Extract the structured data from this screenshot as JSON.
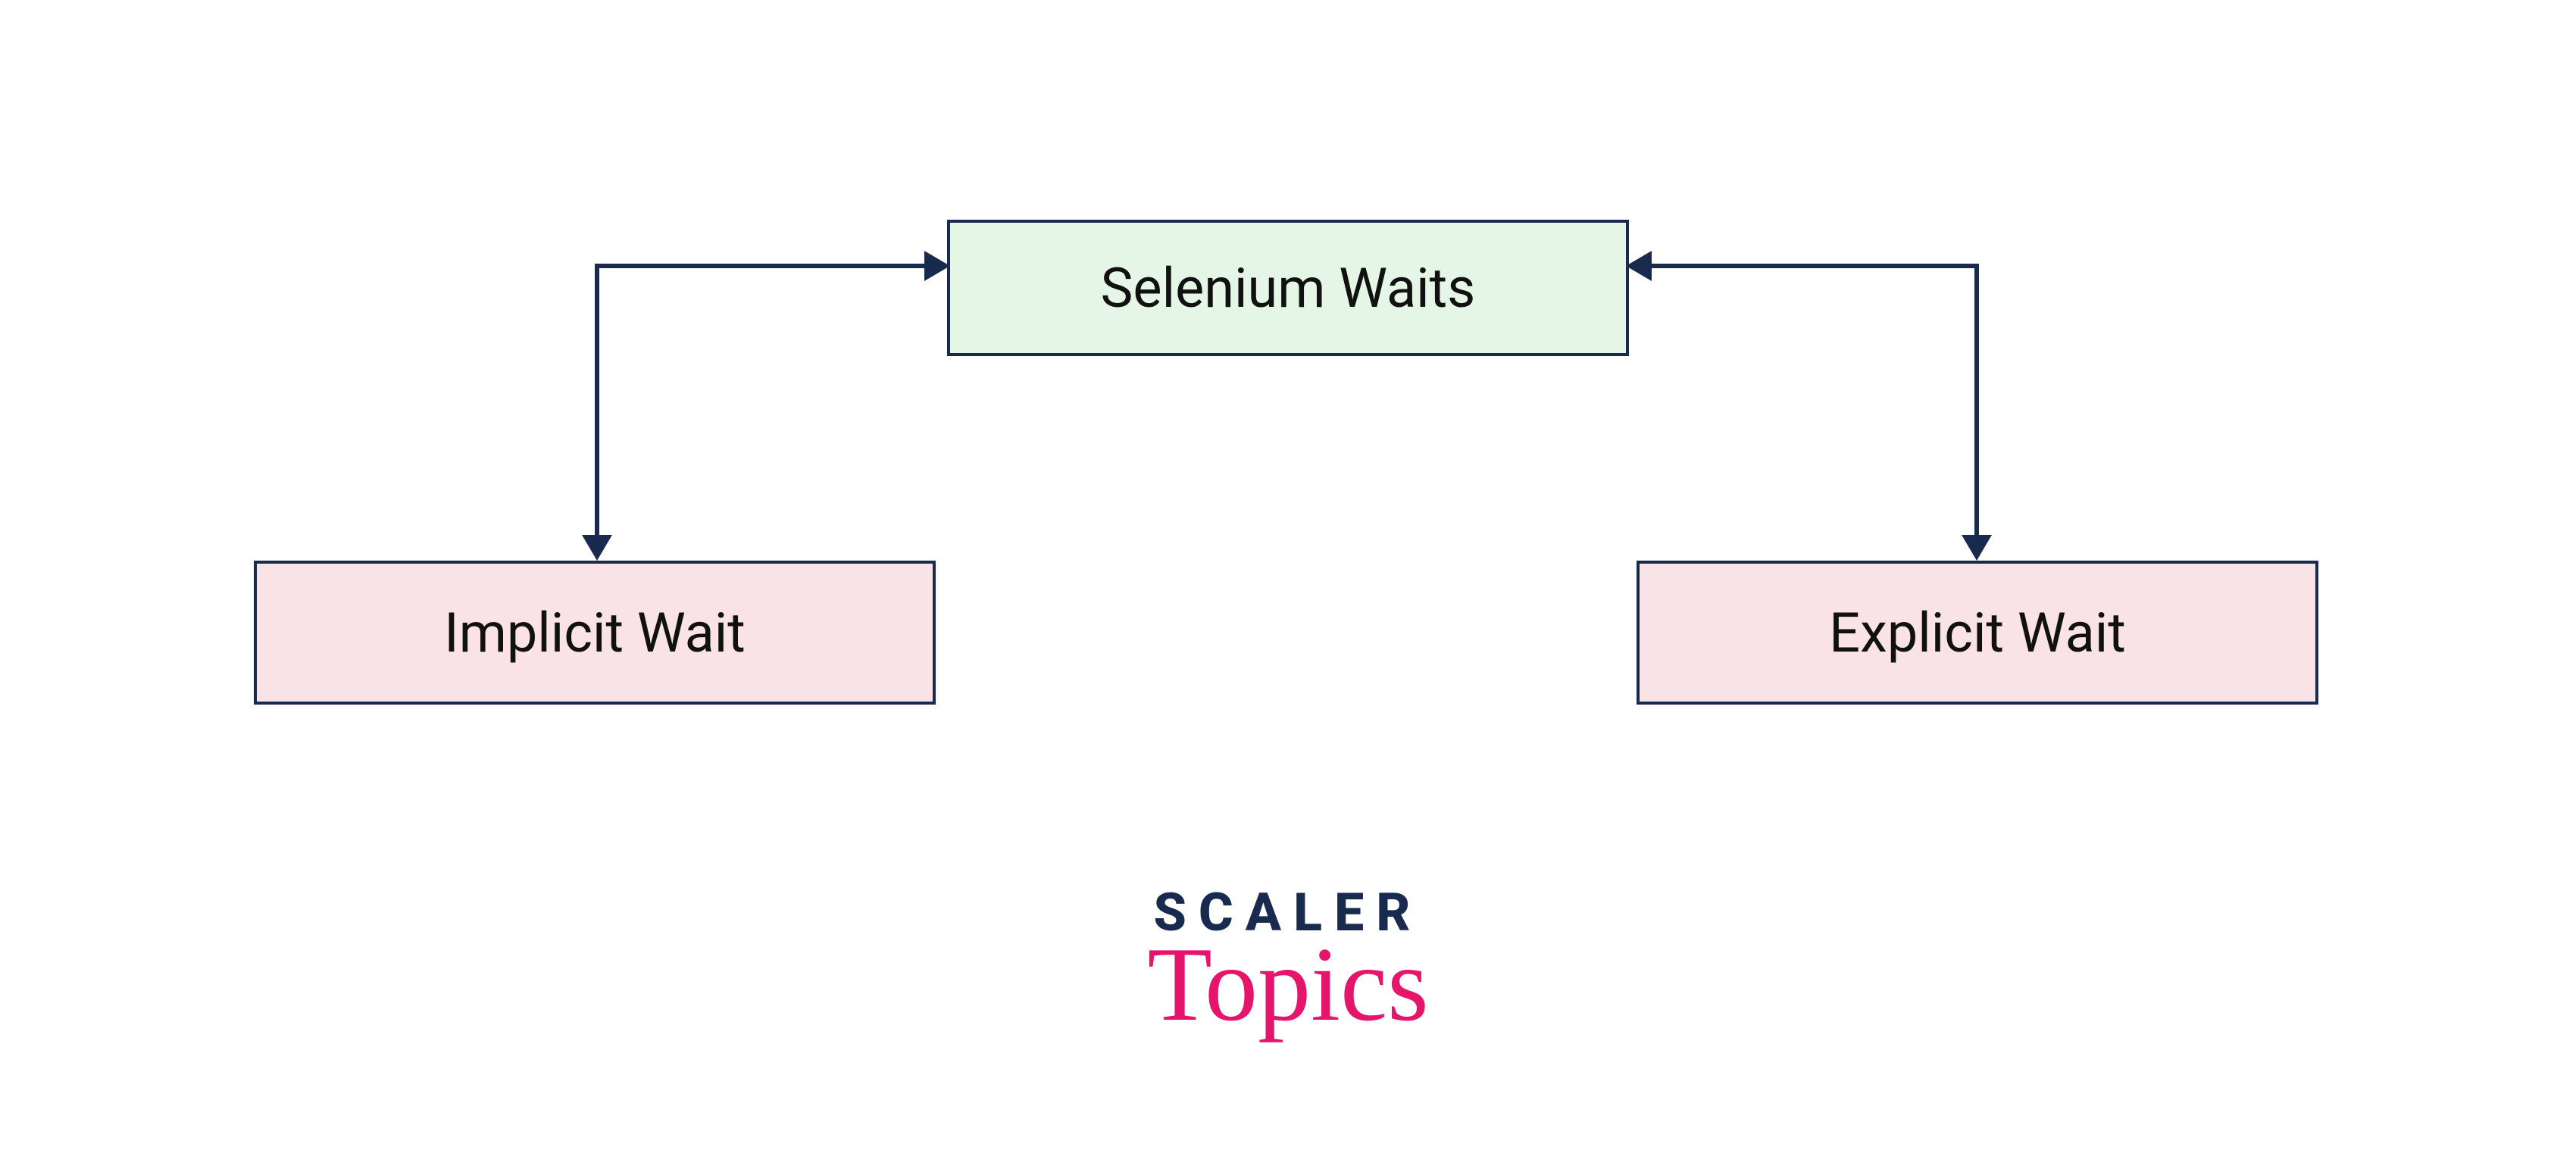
{
  "diagram": {
    "root": {
      "label": "Selenium Waits",
      "bg": "#e6f6e6",
      "border": "#182a4e"
    },
    "children": [
      {
        "label": "Implicit Wait",
        "bg": "#f9e3e6",
        "border": "#182a4e"
      },
      {
        "label": "Explicit Wait",
        "bg": "#f9e3e6",
        "border": "#182a4e"
      }
    ],
    "connector_color": "#182a4e"
  },
  "brand": {
    "line1": "SCALER",
    "line2": "Topics",
    "line1_color": "#182a4e",
    "line2_color": "#e6146b"
  }
}
